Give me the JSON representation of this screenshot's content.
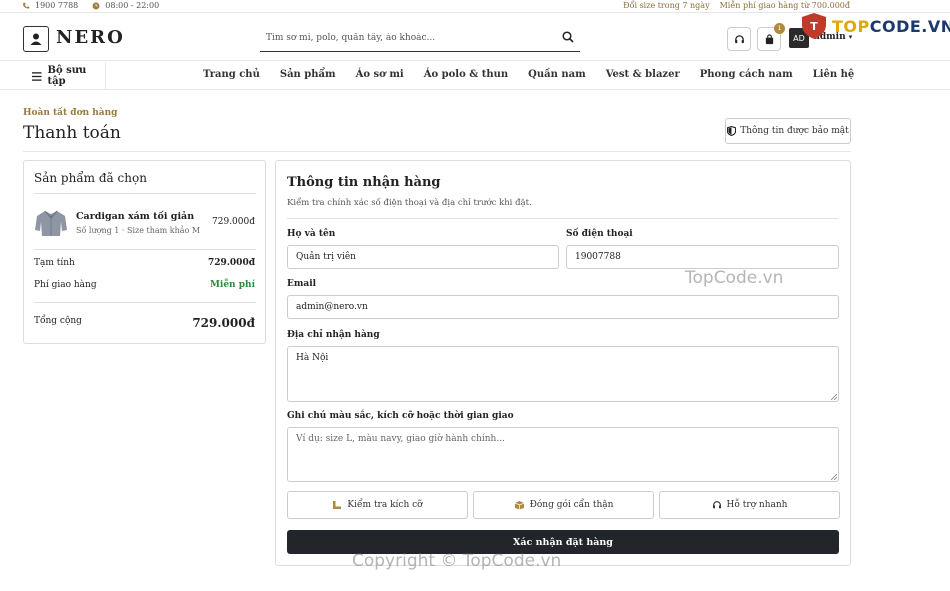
{
  "topbar": {
    "phone": "1900 7788",
    "hours": "08:00 - 22:00",
    "exchange": "Đổi size trong 7 ngày",
    "shipping": "Miễn phí giao hàng từ 700.000đ"
  },
  "header": {
    "brand": "NERO",
    "search_placeholder": "Tìm sơ mi, polo, quần tây, áo khoác...",
    "cart_count": "1",
    "avatar_initials": "AD",
    "user_name": "admin"
  },
  "watermark": {
    "logo_text_a": "TOP",
    "logo_text_b": "CODE.VN",
    "mid": "TopCode.vn",
    "bottom": "Copyright © TopCode.vn"
  },
  "nav": {
    "collection": "Bộ sưu tập",
    "items": [
      "Trang chủ",
      "Sản phẩm",
      "Áo sơ mi",
      "Áo polo & thun",
      "Quần nam",
      "Vest & blazer",
      "Phong cách nam",
      "Liên hệ"
    ]
  },
  "page": {
    "breadcrumb": "Hoàn tất đơn hàng",
    "title": "Thanh toán",
    "secure_label": "Thông tin được bảo mật"
  },
  "summary": {
    "heading": "Sản phẩm đã chọn",
    "product_name": "Cardigan xám tối giản",
    "product_meta": "Số lượng 1 · Size tham khảo M",
    "product_price": "729.000đ",
    "subtotal_label": "Tạm tính",
    "subtotal_value": "729.000đ",
    "shipping_label": "Phí giao hàng",
    "shipping_value": "Miễn phí",
    "total_label": "Tổng cộng",
    "total_value": "729.000đ"
  },
  "form": {
    "heading": "Thông tin nhận hàng",
    "subheading": "Kiểm tra chính xác số điện thoại và địa chỉ trước khi đặt.",
    "name_label": "Họ và tên",
    "name_value": "Quản trị viên",
    "phone_label": "Số điện thoại",
    "phone_value": "19007788",
    "email_label": "Email",
    "email_value": "admin@nero.vn",
    "address_label": "Địa chỉ nhận hàng",
    "address_value": "Hà Nội",
    "note_label": "Ghi chú màu sắc, kích cỡ hoặc thời gian giao",
    "note_placeholder": "Ví dụ: size L, màu navy, giao giờ hành chính...",
    "feature_1": "Kiểm tra kích cỡ",
    "feature_2": "Đóng gói cẩn thận",
    "feature_3": "Hỗ trợ nhanh",
    "submit_label": "Xác nhận đặt hàng"
  },
  "colors": {
    "accent_gold": "#9a7a3e",
    "dark_button": "#22262b",
    "free_green": "#2e8b3e"
  }
}
